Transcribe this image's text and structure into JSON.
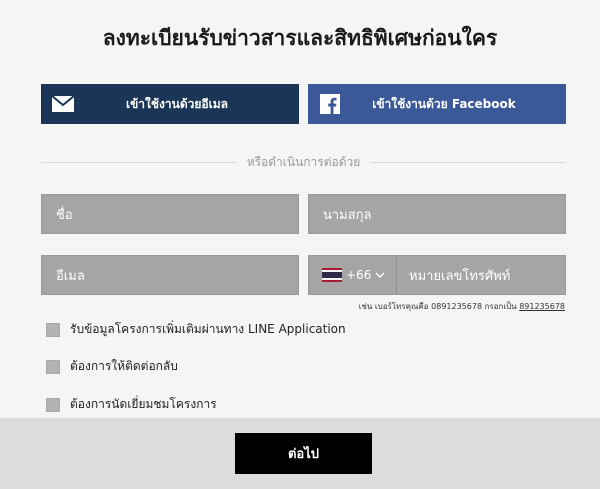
{
  "title": "ลงทะเบียนรับข่าวสารและสิทธิพิเศษก่อนใคร",
  "social": {
    "email_label": "เข้าใช้งานด้วยอีเมล",
    "facebook_label": "เข้าใช้งานด้วย Facebook",
    "email_icon": "envelope-icon",
    "facebook_icon": "facebook-icon"
  },
  "divider_text": "หรือดำเนินการต่อด้วย",
  "form": {
    "name_placeholder": "ชื่อ",
    "surname_placeholder": "นามสกุล",
    "email_placeholder": "อีเมล",
    "country_code": "+66",
    "country_flag": "thailand-flag-icon",
    "phone_placeholder": "หมายเลขโทรศัพท์",
    "hint_prefix": "เช่น เบอร์โทรคุณคือ 0891235678 กรอกเป็น ",
    "hint_example": "891235678"
  },
  "checkboxes": [
    {
      "label": "รับข้อมูลโครงการเพิ่มเติมผ่านทาง LINE Application",
      "checked": false
    },
    {
      "label": "ต้องการให้ติดต่อกลับ",
      "checked": false
    },
    {
      "label": "ต้องการนัดเยี่ยมชมโครงการ",
      "checked": false
    }
  ],
  "next_label": "ต่อไป",
  "colors": {
    "email_button": "#1b3556",
    "facebook_button": "#3b5998",
    "field_bg": "#a5a5a5",
    "next_button": "#000000"
  }
}
